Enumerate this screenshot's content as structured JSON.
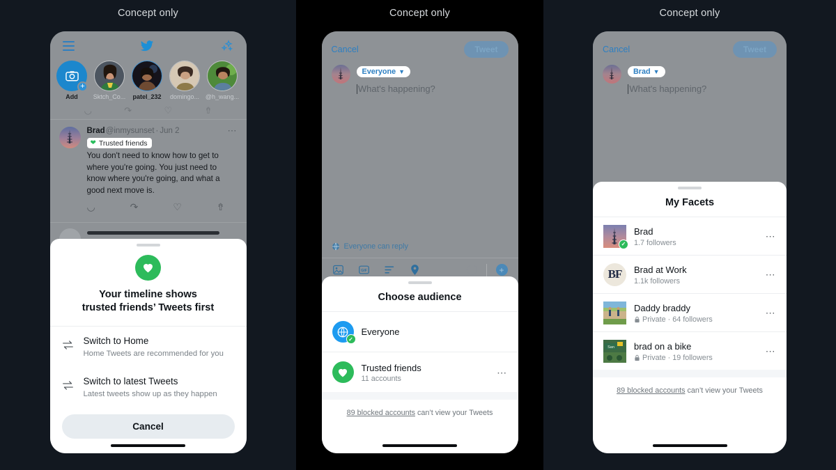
{
  "panels": [
    {
      "concept_label": "Concept only"
    },
    {
      "concept_label": "Concept only"
    },
    {
      "concept_label": "Concept only"
    }
  ],
  "phone1": {
    "topbar": {
      "menu_icon": "hamburger-icon",
      "logo_icon": "twitter-bird-icon",
      "sparkle_icon": "sparkle-icon"
    },
    "stories": [
      {
        "label": "Add",
        "type": "add"
      },
      {
        "label": "Sktch_Co...",
        "type": "avatar"
      },
      {
        "label": "patel_232",
        "type": "avatar",
        "selected": true
      },
      {
        "label": "domingo...",
        "type": "avatar"
      },
      {
        "label": "@h_wang...",
        "type": "avatar"
      }
    ],
    "tweet": {
      "name": "Brad",
      "handle": "@inmysunset",
      "separator": "·",
      "date": "Jun 2",
      "more_icon": "more-horizontal-icon",
      "badge_label": "Trusted friends",
      "badge_icon": "heart-icon",
      "text": "You don't need to know how to get to where you're going. You just need to know where you're going, and what a good next move is.",
      "actions": [
        "reply-icon",
        "retweet-icon",
        "like-icon",
        "share-icon"
      ]
    },
    "sheet": {
      "hero_icon": "heart-icon",
      "title_line1": "Your timeline shows",
      "title_line2": "trusted friends’ Tweets first",
      "options": [
        {
          "icon": "switch-arrows-icon",
          "title": "Switch to Home",
          "subtitle": "Home Tweets are recommended for you"
        },
        {
          "icon": "switch-arrows-icon",
          "title": "Switch to latest Tweets",
          "subtitle": "Latest tweets show up as they happen"
        }
      ],
      "cancel_label": "Cancel"
    }
  },
  "phone2": {
    "compose": {
      "cancel_label": "Cancel",
      "tweet_label": "Tweet",
      "audience_pill": "Everyone",
      "audience_chevron": "chevron-down-icon",
      "placeholder": "What's happening?",
      "reply_note": "Everyone can reply",
      "reply_icon": "globe-icon",
      "toolbar": [
        "image-icon",
        "gif-icon",
        "poll-icon",
        "location-icon"
      ],
      "progress_icon": "progress-ring-icon",
      "add_icon": "plus-circle-icon"
    },
    "sheet": {
      "title": "Choose audience",
      "rows": [
        {
          "icon": "globe-icon",
          "icon_color": "#1d9bf0",
          "name": "Everyone",
          "subtitle": "",
          "selected": true,
          "more": false
        },
        {
          "icon": "heart-icon",
          "icon_color": "#2dbb5b",
          "name": "Trusted friends",
          "subtitle": "11 accounts",
          "selected": false,
          "more": true
        }
      ],
      "blocked_link": "89 blocked accounts",
      "blocked_rest": " can’t view your Tweets"
    }
  },
  "phone3": {
    "compose": {
      "cancel_label": "Cancel",
      "tweet_label": "Tweet",
      "audience_pill": "Brad",
      "audience_chevron": "chevron-down-icon",
      "placeholder": "What's happening?"
    },
    "sheet": {
      "title": "My Facets",
      "rows": [
        {
          "name": "Brad",
          "subtitle": "1.7 followers",
          "private": false,
          "selected": true,
          "avatar_type": "photo-tower",
          "more": "more-horizontal-icon"
        },
        {
          "name": "Brad at Work",
          "subtitle": "1.1k followers",
          "private": false,
          "selected": false,
          "avatar_type": "monogram-BF",
          "monogram": "BF",
          "more": "more-horizontal-icon"
        },
        {
          "name": "Daddy braddy",
          "subtitle": "Private · 64 followers",
          "private": true,
          "selected": false,
          "avatar_type": "photo-park",
          "more": "more-horizontal-icon"
        },
        {
          "name": "brad on a bike",
          "subtitle": "Private · 19 followers",
          "private": true,
          "selected": false,
          "avatar_type": "photo-sign",
          "more": "more-horizontal-icon"
        }
      ],
      "blocked_link": "89 blocked accounts",
      "blocked_rest": " can’t view your Tweets"
    }
  },
  "colors": {
    "green": "#2dbb5b",
    "blue": "#1d9bf0",
    "panel_dark": "#121820",
    "panel_black": "#000000",
    "dim_overlay": "#8e9296"
  }
}
